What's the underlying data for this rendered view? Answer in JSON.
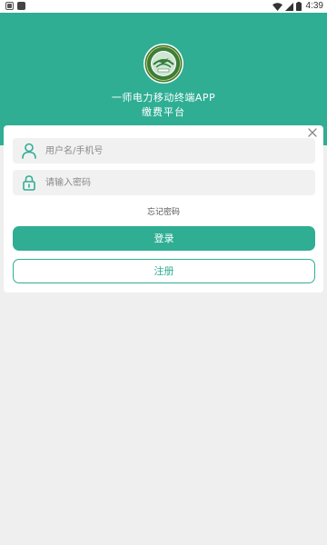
{
  "status_bar": {
    "time": "4:39",
    "icons": [
      "notification-app-icon",
      "notification-app-icon",
      "wifi-icon",
      "signal-icon",
      "battery-icon"
    ]
  },
  "header": {
    "logo": "logo-emblem",
    "title": "一师电力移动终端APP",
    "subtitle": "缴费平台",
    "background": "#2fae94"
  },
  "login_form": {
    "close_icon": "close-icon",
    "username": {
      "icon": "user-icon",
      "placeholder": "用户名/手机号",
      "value": ""
    },
    "password": {
      "icon": "lock-icon",
      "placeholder": "请输入密码",
      "value": ""
    },
    "forgot_label": "忘记密码",
    "login_label": "登录",
    "register_label": "注册"
  },
  "colors": {
    "accent": "#2fae94",
    "page_background": "#efefef",
    "card_background": "#ffffff",
    "field_background": "#f1f1f1"
  }
}
